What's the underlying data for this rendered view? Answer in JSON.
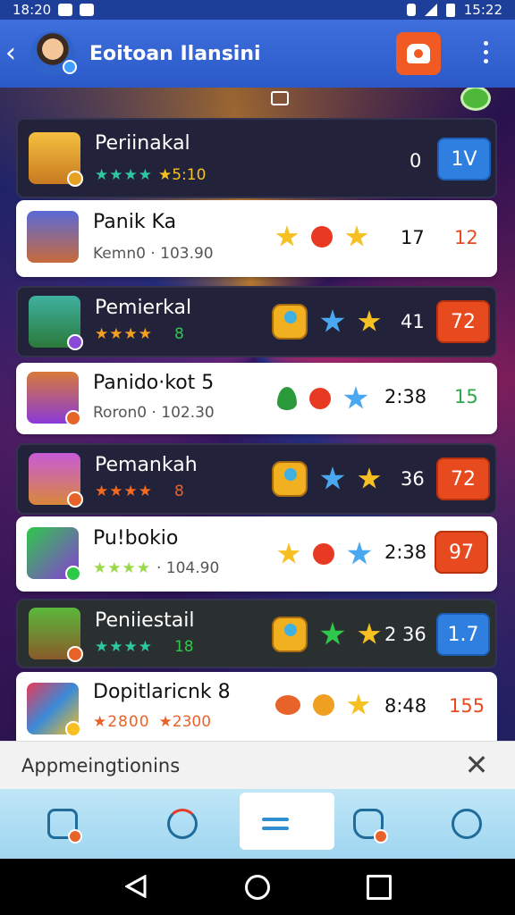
{
  "status_bar": {
    "time": "18:20",
    "right_time": "15:22"
  },
  "app_bar": {
    "title": "Eoitoan Ilansini",
    "back_icon": "chevron-left-icon",
    "action_icon": "robot-icon",
    "menu_icon": "more-vertical-icon"
  },
  "colors": {
    "app_bar": "#2b59c9",
    "score_blue": "#2f7fe0",
    "score_red": "#e84a20",
    "notice_bg": "#f2f2f3",
    "bottom_nav": "#bfe6f7"
  },
  "rows": [
    {
      "name": "Periinakal",
      "stars": "★★★★",
      "sub_value": "★5:10",
      "icons": [],
      "number": "0",
      "score": "1V",
      "score_style": "blue",
      "theme": "dark"
    },
    {
      "name": "Panik Ka",
      "sub_text": "Kemn0 · 103.90",
      "icons": [
        "star-gold",
        "gem-icon",
        "star-gold"
      ],
      "number": "17",
      "score": "12",
      "score_style": "plain",
      "theme": "light"
    },
    {
      "name": "Pemierkal",
      "stars": "★★★★",
      "sub_value": "8",
      "icons": [
        "medal-icon",
        "star-blue",
        "star-gold"
      ],
      "number": "41",
      "score": "72",
      "score_style": "red",
      "theme": "dark"
    },
    {
      "name": "Panido·kot 5",
      "sub_text": "Roron0 · 102.30",
      "icons": [
        "leaf-icon",
        "gem-icon",
        "star-blue"
      ],
      "number": "2:38",
      "score": "15",
      "score_style": "plain",
      "theme": "light"
    },
    {
      "name": "Pemankah",
      "stars": "★★★★",
      "sub_value": "8",
      "icons": [
        "medal-icon",
        "star-blue",
        "star-gold"
      ],
      "number": "36",
      "score": "72",
      "score_style": "red",
      "theme": "dark"
    },
    {
      "name": "Pu!bokio",
      "stars": "★★★★",
      "sub_value": "· 104.90",
      "icons": [
        "star-gold",
        "gem-icon",
        "star-blue"
      ],
      "number": "2:38",
      "score": "97",
      "score_style": "red",
      "theme": "light"
    },
    {
      "name": "Peniiestail",
      "stars": "★★★★",
      "sub_value": "18",
      "icons": [
        "medal-icon",
        "star-green",
        "star-gold"
      ],
      "number": "2 36",
      "score": "1.7",
      "score_style": "blue",
      "theme": "dark"
    },
    {
      "name": "Dopitlaricnk 8",
      "stars": "★2800",
      "sub_value": "★2300",
      "icons": [
        "badge-icon",
        "medal-icon",
        "star-gold"
      ],
      "number": "8:48",
      "score": "155",
      "score_style": "plain",
      "theme": "light"
    }
  ],
  "notice": {
    "text": "Appmeingtionins"
  },
  "bottom_nav": {
    "items": [
      "home-icon",
      "refresh-icon",
      "menu-icon",
      "bag-icon",
      "profile-icon"
    ],
    "active_index": 2
  }
}
